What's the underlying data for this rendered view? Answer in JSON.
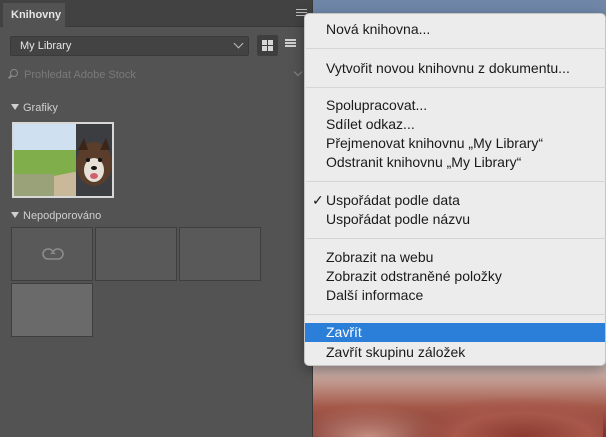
{
  "panel": {
    "tab_label": "Knihovny",
    "library_selected": "My Library",
    "search_placeholder": "Prohledat Adobe Stock",
    "sections": [
      {
        "title": "Grafiky"
      },
      {
        "title": "Nepodporováno"
      }
    ]
  },
  "menu": {
    "items": [
      "Nová knihovna...",
      "Vytvořit novou knihovnu z dokumentu...",
      "Spolupracovat...",
      "Sdílet odkaz...",
      "Přejmenovat knihovnu „My Library“",
      "Odstranit knihovnu „My Library“",
      "Uspořádat podle data",
      "Uspořádat podle názvu",
      "Zobrazit na webu",
      "Zobrazit odstraněné položky",
      "Další informace",
      "Zavřít",
      "Zavřít skupinu záložek"
    ],
    "checked_item": "Uspořádat podle data",
    "highlighted_item": "Zavřít",
    "check_glyph": "✓"
  },
  "colors": {
    "panel_bg": "#535353",
    "menu_bg": "#ececec",
    "highlight": "#2b7fd8"
  }
}
